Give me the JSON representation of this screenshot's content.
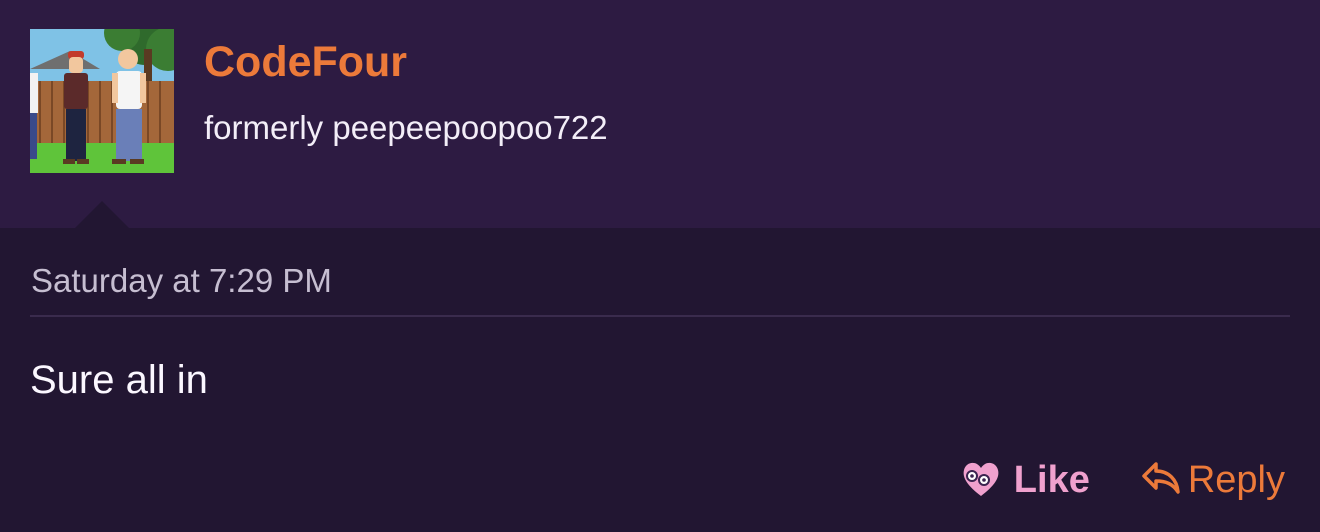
{
  "post": {
    "author": {
      "username": "CodeFour",
      "user_title": "formerly peepeepoopoo722",
      "avatar_icon": "cartoon-avatar"
    },
    "timestamp": "Saturday at 7:29 PM",
    "message": "Sure all in",
    "actions": {
      "like_label": "Like",
      "like_icon": "heart-face-icon",
      "reply_label": "Reply",
      "reply_icon": "reply-arrow-icon"
    }
  },
  "colors": {
    "header_bg": "#2d1b42",
    "body_bg": "#221632",
    "username": "#ec7a3a",
    "like": "#f0a1ce",
    "reply": "#ec7a3a"
  }
}
